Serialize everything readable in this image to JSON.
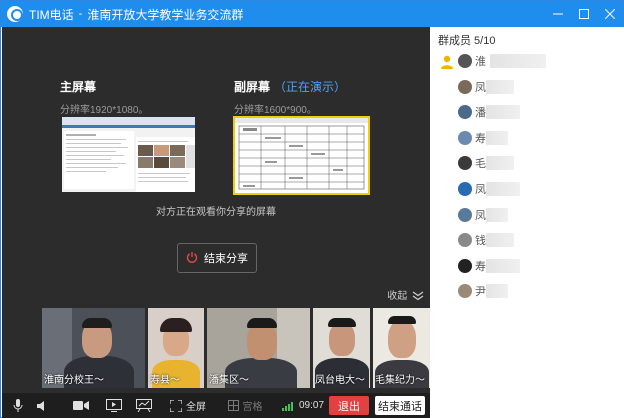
{
  "window": {
    "app_name": "TIM电话",
    "separator": "-",
    "group_name": "淮南开放大学教学业务交流群",
    "buttons": [
      "minimize",
      "maximize",
      "close"
    ]
  },
  "screens": {
    "main": {
      "title": "主屏幕",
      "resolution": "分辨率1920*1080。"
    },
    "secondary": {
      "title": "副屏幕",
      "status": "（正在演示）",
      "resolution": "分辨率1600*900。"
    }
  },
  "share": {
    "viewing_text": "对方正在观看你分享的屏幕",
    "end_share_label": "结束分享"
  },
  "collapse_label": "收起",
  "videos": [
    {
      "label": "淮南分校王～"
    },
    {
      "label": "寿县～"
    },
    {
      "label": "潘集区～"
    },
    {
      "label": "凤台电大～"
    },
    {
      "label": "毛集纪力～"
    }
  ],
  "toolbar": {
    "fullscreen_label": "全屏",
    "grid_label": "宫格",
    "timer": "09:07",
    "exit_label": "退出",
    "end_call_label": "结束通话"
  },
  "sidebar": {
    "members_title": "群成员 5/10",
    "members": [
      {
        "name": "淮",
        "avatar_color": "#555555"
      },
      {
        "name": "凤",
        "avatar_color": "#7a6a5a"
      },
      {
        "name": "潘",
        "avatar_color": "#4a6a8a"
      },
      {
        "name": "寿",
        "avatar_color": "#6a8ab0"
      },
      {
        "name": "毛",
        "avatar_color": "#3a3a3a"
      },
      {
        "name": "凤",
        "avatar_color": "#2a6ab0"
      },
      {
        "name": "凤",
        "avatar_color": "#5a7a9a"
      },
      {
        "name": "钱",
        "avatar_color": "#8a8a8a"
      },
      {
        "name": "寿",
        "avatar_color": "#222222"
      },
      {
        "name": "尹",
        "avatar_color": "#9a8a7a"
      }
    ]
  },
  "colors": {
    "titlebar": "#1f8ded",
    "main_bg": "#2c2c2c",
    "demo_blue": "#4ca3ff",
    "active_border": "#f0d000",
    "exit_red": "#e14141",
    "timer_green": "#3cc35a"
  }
}
